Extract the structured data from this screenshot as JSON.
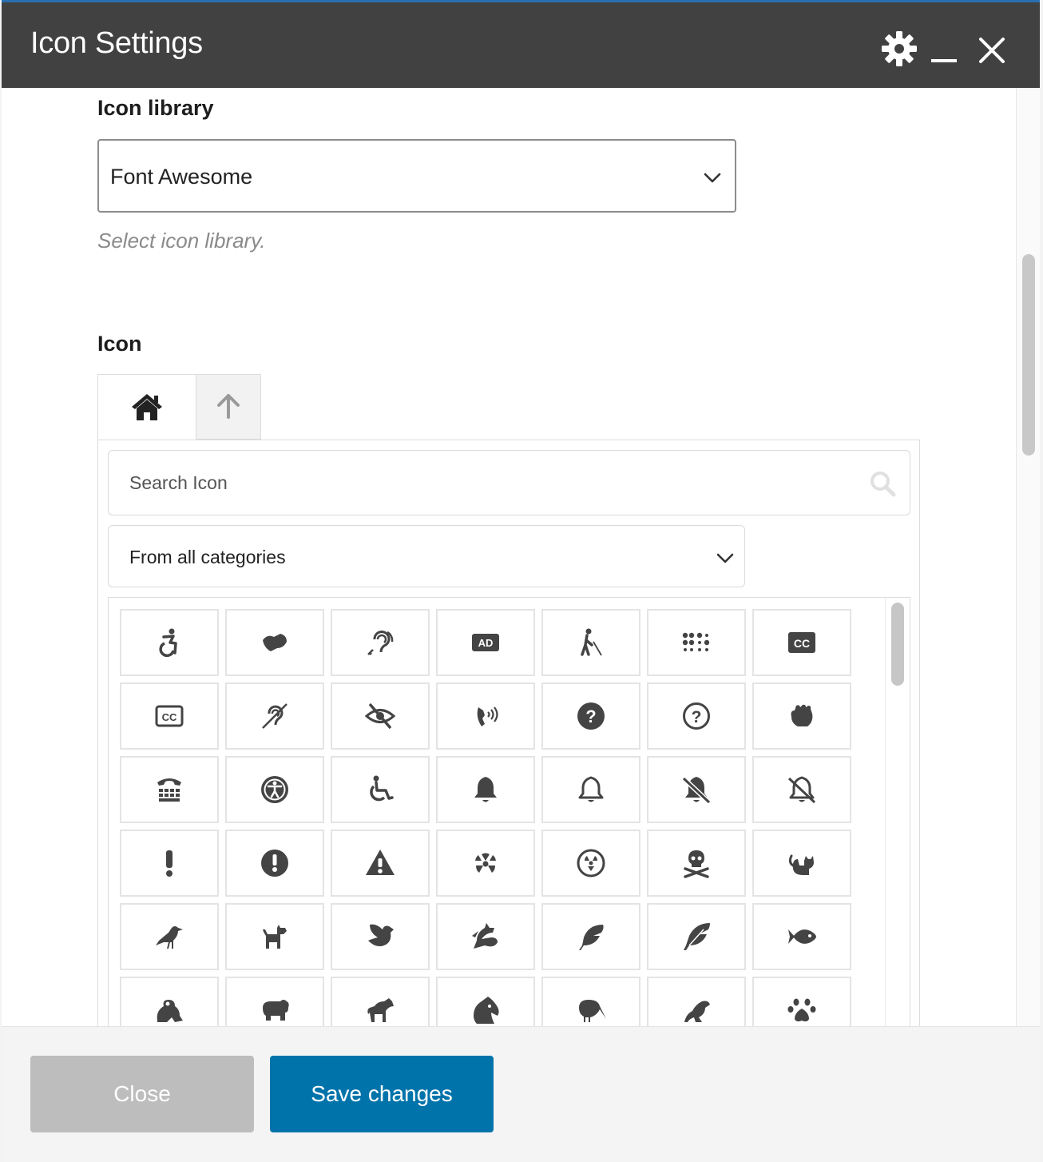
{
  "window": {
    "title": "Icon Settings",
    "controls": [
      "gear-icon",
      "minimize-icon",
      "close-icon"
    ]
  },
  "icon_library": {
    "label": "Icon library",
    "selected": "Font Awesome",
    "help": "Select icon library."
  },
  "icon": {
    "label": "Icon",
    "tabs": [
      "home-icon",
      "arrow-up-icon"
    ],
    "search_placeholder": "Search Icon",
    "category": "From all categories",
    "grid": [
      [
        "accessible-icon",
        "american-sign-language-interpreting-icon",
        "assistive-listening-systems-icon",
        "audio-description-icon",
        "blind-icon",
        "braille-icon",
        "closed-captioning-icon"
      ],
      [
        "closed-captioning-outline-icon",
        "deaf-icon",
        "low-vision-icon",
        "phone-volume-icon",
        "question-circle-icon",
        "question-circle-outline-icon",
        "sign-language-icon"
      ],
      [
        "tty-icon",
        "universal-access-icon",
        "wheelchair-icon",
        "bell-icon",
        "bell-outline-icon",
        "bell-slash-icon",
        "bell-slash-outline-icon"
      ],
      [
        "exclamation-icon",
        "exclamation-circle-icon",
        "exclamation-triangle-icon",
        "radiation-icon",
        "radiation-alt-icon",
        "skull-crossbones-icon",
        "cat-icon"
      ],
      [
        "crow-icon",
        "dog-icon",
        "dove-icon",
        "dragon-icon",
        "feather-icon",
        "feather-alt-icon",
        "fish-icon"
      ],
      [
        "frog-icon",
        "hippo-icon",
        "horse-icon",
        "horse-head-icon",
        "kiwi-bird-icon",
        "otter-icon",
        "paw-icon"
      ]
    ]
  },
  "footer": {
    "close_label": "Close",
    "save_label": "Save changes"
  },
  "colors": {
    "titlebar": "#414141",
    "primary": "#0073aa",
    "disabled": "#bdbdbd",
    "icon": "#444444"
  }
}
